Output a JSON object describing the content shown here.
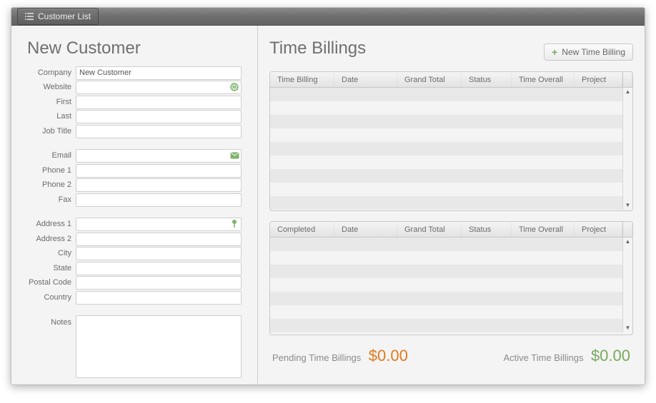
{
  "toolbar": {
    "customer_list": "Customer List"
  },
  "left": {
    "title": "New Customer",
    "labels": {
      "company": "Company",
      "website": "Website",
      "first": "First",
      "last": "Last",
      "job_title": "Job Title",
      "email": "Email",
      "phone1": "Phone 1",
      "phone2": "Phone 2",
      "fax": "Fax",
      "address1": "Address 1",
      "address2": "Address 2",
      "city": "City",
      "state": "State",
      "postal": "Postal Code",
      "country": "Country",
      "notes": "Notes"
    },
    "values": {
      "company": "New Customer"
    }
  },
  "right": {
    "title": "Time Billings",
    "new_button": "New Time Billing",
    "table1_cols": {
      "c1": "Time Billing",
      "c2": "Date",
      "c3": "Grand Total",
      "c4": "Status",
      "c5": "Time Overall",
      "c6": "Project"
    },
    "table2_cols": {
      "c1": "Completed",
      "c2": "Date",
      "c3": "Grand Total",
      "c4": "Status",
      "c5": "Time Overall",
      "c6": "Project"
    },
    "pending_label": "Pending Time Billings",
    "pending_value": "$0.00",
    "active_label": "Active Time Billings",
    "active_value": "$0.00"
  }
}
